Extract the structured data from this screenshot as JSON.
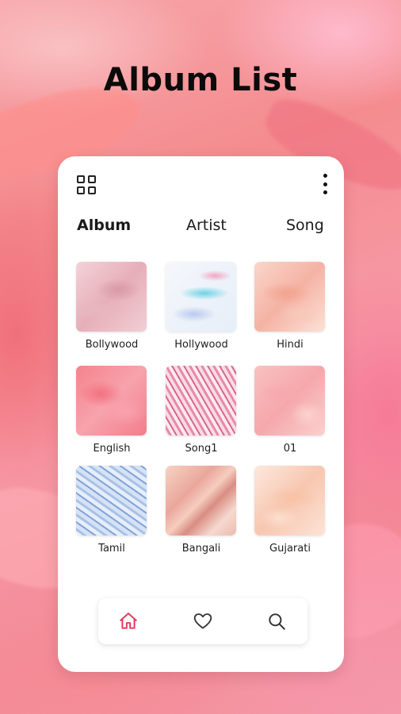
{
  "page": {
    "title": "Album List"
  },
  "tabs": [
    {
      "label": "Album",
      "active": true
    },
    {
      "label": "Artist",
      "active": false
    },
    {
      "label": "Song",
      "active": false
    }
  ],
  "albums": [
    {
      "label": "Bollywood"
    },
    {
      "label": "Hollywood"
    },
    {
      "label": "Hindi"
    },
    {
      "label": "English"
    },
    {
      "label": "Song1"
    },
    {
      "label": "01"
    },
    {
      "label": "Tamil"
    },
    {
      "label": "Bangali"
    },
    {
      "label": "Gujarati"
    }
  ],
  "icons": {
    "top_left": "grid-view-icon",
    "top_right": "more-vertical-icon",
    "nav": [
      "home-icon",
      "heart-icon",
      "search-icon"
    ]
  },
  "colors": {
    "accent": "#e8365a",
    "text": "#1a1a1a"
  }
}
